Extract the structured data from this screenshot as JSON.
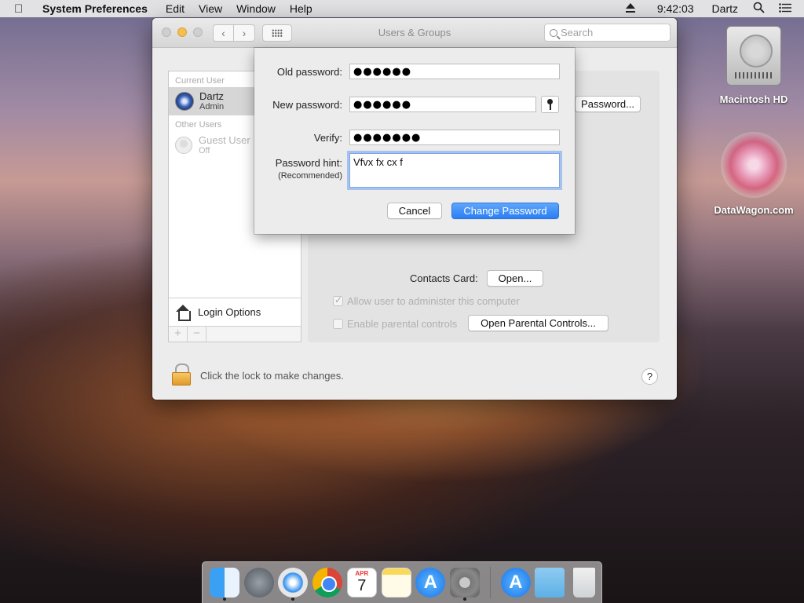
{
  "menubar": {
    "app_name": "System Preferences",
    "menus": [
      "Edit",
      "View",
      "Window",
      "Help"
    ],
    "clock": "9:42:03",
    "user": "Dartz"
  },
  "desktop": {
    "icons": [
      {
        "label": "Macintosh HD"
      },
      {
        "label": "DataWagon.com"
      }
    ]
  },
  "window": {
    "title": "Users & Groups",
    "search_placeholder": "Search"
  },
  "sidebar": {
    "current_user_header": "Current User",
    "current_user": {
      "name": "Dartz",
      "role": "Admin"
    },
    "other_users_header": "Other Users",
    "guest_user": {
      "name": "Guest User",
      "role": "Off"
    },
    "login_options": "Login Options",
    "add_label": "+",
    "remove_label": "−"
  },
  "panel": {
    "change_password_button": "Password...",
    "contacts_card_label": "Contacts Card:",
    "open_button": "Open...",
    "allow_admin_label": "Allow user to administer this computer",
    "allow_admin_checked": true,
    "parental_label": "Enable parental controls",
    "parental_checked": false,
    "open_parental_button": "Open Parental Controls..."
  },
  "lock_bar": {
    "text": "Click the lock to make changes.",
    "help": "?"
  },
  "sheet": {
    "old_password_label": "Old password:",
    "old_password_value": "●●●●●●",
    "new_password_label": "New password:",
    "new_password_value": "●●●●●●",
    "verify_label": "Verify:",
    "verify_value": "●●●●●●●",
    "hint_label": "Password hint:",
    "hint_sublabel": "(Recommended)",
    "hint_value": "Vfvx fx cx f",
    "cancel_button": "Cancel",
    "change_button": "Change Password"
  },
  "dock": {
    "calendar_month": "APR",
    "calendar_day": "7",
    "app_store_glyph": "A"
  }
}
